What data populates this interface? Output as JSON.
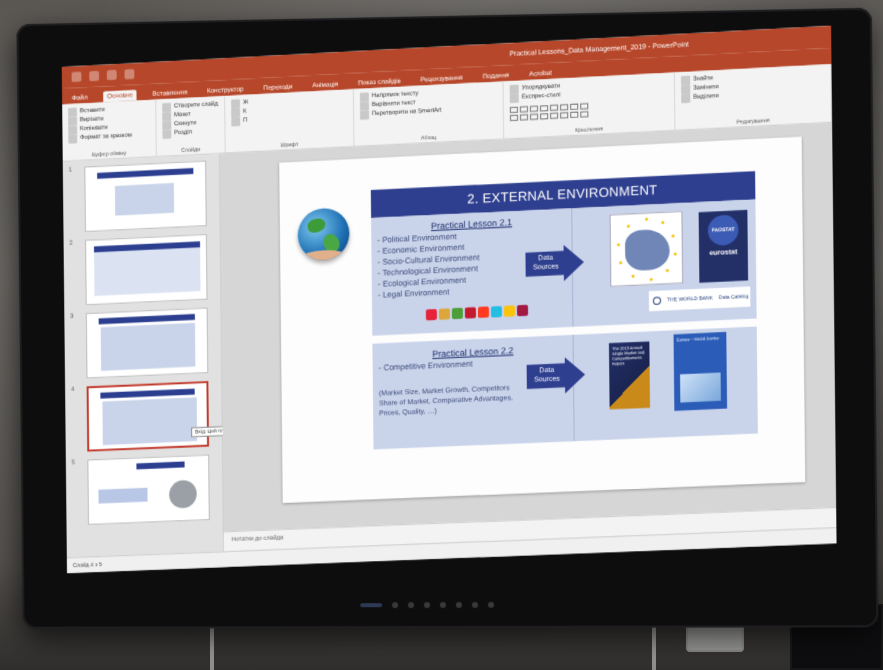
{
  "powerpoint": {
    "window_title": "Practical Lessons_Data Management_2019 - PowerPoint",
    "tabs": [
      "Файл",
      "Основне",
      "Вставлення",
      "Конструктор",
      "Переходи",
      "Анімація",
      "Показ слайдів",
      "Рецензування",
      "Подання",
      "Acrobat"
    ],
    "active_tab": "Основне",
    "ribbon_groups": [
      {
        "label": "Буфер обміну",
        "buttons": [
          "Вставити",
          "Вирізати",
          "Копіювати",
          "Формат за зразком"
        ]
      },
      {
        "label": "Слайди",
        "buttons": [
          "Створити слайд",
          "Макет",
          "Скинути",
          "Розділ"
        ]
      },
      {
        "label": "Шрифт",
        "buttons": [
          "Ж",
          "К",
          "П"
        ]
      },
      {
        "label": "Абзац",
        "buttons": [
          "Напрямок тексту",
          "Вирівняти текст",
          "Перетворити на SmartArt"
        ]
      },
      {
        "label": "Креслення",
        "buttons": [
          "Упорядкувати",
          "Експрес-стилі"
        ]
      },
      {
        "label": "Редагування",
        "buttons": [
          "Знайти",
          "Замінити",
          "Виділити"
        ]
      }
    ],
    "notes_placeholder": "Нотатки до слайда",
    "status": "Слайд 4 з 5",
    "thumb_numbers": [
      "1",
      "2",
      "3",
      "4",
      "5"
    ],
    "tooltip": "Вхід: Цей платник (Клацніть)"
  },
  "slide": {
    "title": "2. EXTERNAL ENVIRONMENT",
    "lesson1": {
      "title": "Practical Lesson 2.1",
      "items": [
        "Political Environment",
        "Economic Environment",
        "Socio-Cultural Environment",
        "Technological Environment",
        "Ecological Environment",
        "Legal Environment"
      ],
      "arrow_label": "Data Sources",
      "eurostat_logo": "FAOSTAT",
      "eurostat_name": "eurostat",
      "worldbank": "THE WORLD BANK",
      "worldbank_tag": "Data Catalog"
    },
    "lesson2": {
      "title": "Practical Lesson 2.2",
      "items": [
        "Competitive Environment"
      ],
      "note": "(Market Size, Market Growth, Competitors Share of Market, Comparative Advantages, Prices, Quality, …)",
      "arrow_label": "Data Sources",
      "report1": "The 2019 Annual Single Market and Competitiveness Report",
      "report2": "Europe – Social Justice"
    },
    "colors": {
      "header": "#2f3f8f",
      "panel": "#c9d3ea",
      "arrow": "#2f3f8f",
      "ppt_accent": "#b7472a"
    },
    "sdg_colors": [
      "#e5243b",
      "#dda63a",
      "#4c9f38",
      "#c5192d",
      "#ff3a21",
      "#26bde2",
      "#fcc30b",
      "#a21942"
    ]
  }
}
